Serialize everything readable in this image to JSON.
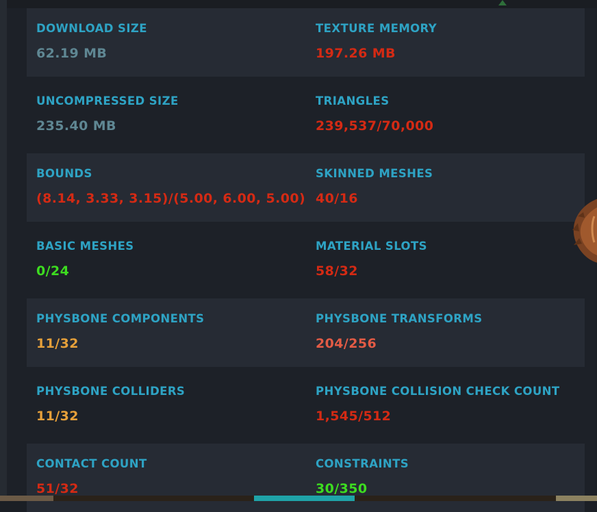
{
  "colors": {
    "label": "#2ea3c4",
    "neutral": "#5f8793",
    "red": "#d42a14",
    "green": "#3ddc20",
    "orange": "#e6a03a",
    "salmon": "#e35b45"
  },
  "stats": [
    [
      {
        "label": "DOWNLOAD SIZE",
        "value": "62.19 MB",
        "status": "neutral"
      },
      {
        "label": "TEXTURE MEMORY",
        "value": "197.26 MB",
        "status": "red"
      }
    ],
    [
      {
        "label": "UNCOMPRESSED SIZE",
        "value": "235.40 MB",
        "status": "neutral"
      },
      {
        "label": "TRIANGLES",
        "value": "239,537/70,000",
        "status": "red"
      }
    ],
    [
      {
        "label": "BOUNDS",
        "value": "(8.14, 3.33, 3.15)/(5.00, 6.00, 5.00)",
        "status": "red"
      },
      {
        "label": "SKINNED MESHES",
        "value": "40/16",
        "status": "red"
      }
    ],
    [
      {
        "label": "BASIC MESHES",
        "value": "0/24",
        "status": "green"
      },
      {
        "label": "MATERIAL SLOTS",
        "value": "58/32",
        "status": "red"
      }
    ],
    [
      {
        "label": "PHYSBONE COMPONENTS",
        "value": "11/32",
        "status": "orange"
      },
      {
        "label": "PHYSBONE TRANSFORMS",
        "value": "204/256",
        "status": "salmon"
      }
    ],
    [
      {
        "label": "PHYSBONE COLLIDERS",
        "value": "11/32",
        "status": "orange"
      },
      {
        "label": "PHYSBONE COLLISION CHECK COUNT",
        "value": "1,545/512",
        "status": "red"
      }
    ],
    [
      {
        "label": "CONTACT COUNT",
        "value": "51/32",
        "status": "red"
      },
      {
        "label": "CONSTRAINTS",
        "value": "30/350",
        "status": "green"
      }
    ]
  ]
}
